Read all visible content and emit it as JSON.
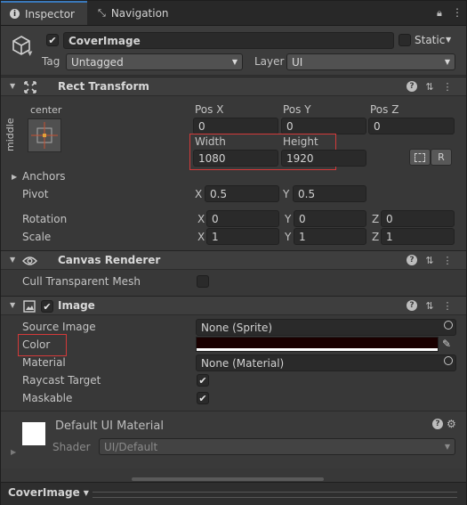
{
  "tabs": [
    {
      "label": "Inspector",
      "icon": "info-icon",
      "active": true
    },
    {
      "label": "Navigation",
      "icon": "navigation-icon",
      "active": false
    }
  ],
  "gameobject": {
    "name": "CoverImage",
    "static_label": "Static",
    "tag_label": "Tag",
    "tag_value": "Untagged",
    "layer_label": "Layer",
    "layer_value": "UI"
  },
  "rect_transform": {
    "title": "Rect Transform",
    "anchor_h": "center",
    "anchor_v": "middle",
    "pos_x_label": "Pos X",
    "pos_y_label": "Pos Y",
    "pos_z_label": "Pos Z",
    "pos_x": "0",
    "pos_y": "0",
    "pos_z": "0",
    "width_label": "Width",
    "height_label": "Height",
    "width": "1080",
    "height": "1920",
    "raw_button": "R",
    "anchors_label": "Anchors",
    "pivot_label": "Pivot",
    "pivot_x": "0.5",
    "pivot_y": "0.5",
    "rotation_label": "Rotation",
    "rot_x": "0",
    "rot_y": "0",
    "rot_z": "0",
    "scale_label": "Scale",
    "scale_x": "1",
    "scale_y": "1",
    "scale_z": "1",
    "axis_x": "X",
    "axis_y": "Y",
    "axis_z": "Z"
  },
  "canvas_renderer": {
    "title": "Canvas Renderer",
    "cull_label": "Cull Transparent Mesh"
  },
  "image": {
    "title": "Image",
    "source_label": "Source Image",
    "source_value": "None (Sprite)",
    "color_label": "Color",
    "color_value": "#1a0000",
    "material_label": "Material",
    "material_value": "None (Material)",
    "raycast_label": "Raycast Target",
    "maskable_label": "Maskable"
  },
  "material_preview": {
    "name": "Default UI Material",
    "shader_label": "Shader",
    "shader_value": "UI/Default"
  },
  "footer": {
    "object_label": "CoverImage"
  },
  "colors": {
    "accent": "#3a79bb",
    "highlight": "#d43a3a",
    "background": "#383838"
  }
}
